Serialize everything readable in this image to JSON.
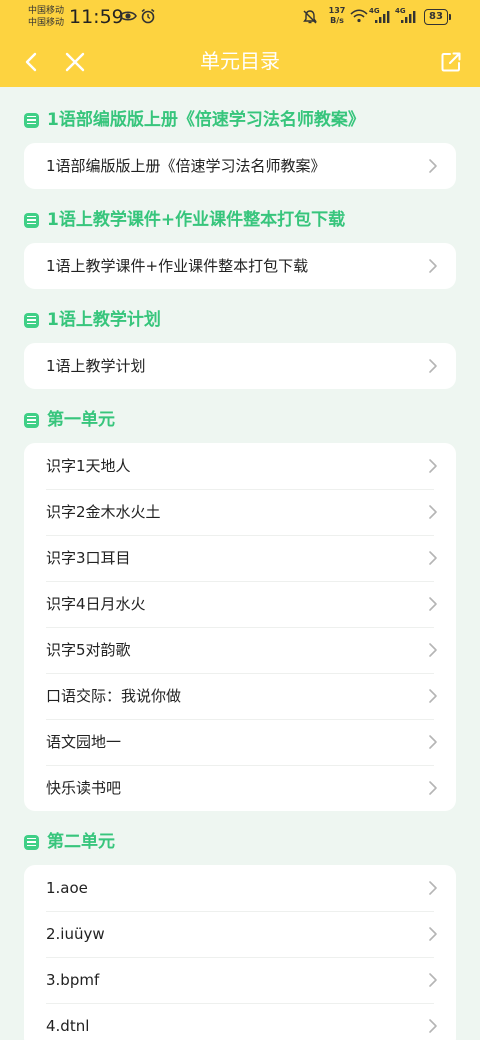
{
  "status_bar": {
    "carrier_1": "中国移动",
    "carrier_2": "中国移动",
    "time": "11:59",
    "net_speed_value": "137",
    "net_speed_unit": "B/s",
    "signal_1_label": "4G",
    "signal_2_label": "4G",
    "battery": "83"
  },
  "nav": {
    "title": "单元目录",
    "back_icon": "chevron-left-icon",
    "close_icon": "close-icon",
    "share_icon": "share-icon"
  },
  "sections": [
    {
      "title": "1语部编版版上册《倍速学习法名师教案》",
      "items": [
        "1语部编版版上册《倍速学习法名师教案》"
      ]
    },
    {
      "title": "1语上教学课件+作业课件整本打包下载",
      "items": [
        "1语上教学课件+作业课件整本打包下载"
      ]
    },
    {
      "title": "1语上教学计划",
      "items": [
        "1语上教学计划"
      ]
    },
    {
      "title": "第一单元",
      "items": [
        "识字1天地人",
        "识字2金木水火土",
        "识字3口耳目",
        "识字4日月水火",
        "识字5对韵歌",
        "口语交际：我说你做",
        "语文园地一",
        "快乐读书吧"
      ]
    },
    {
      "title": "第二单元",
      "items": [
        "1.aoe",
        "2.iuüyw",
        "3.bpmf",
        "4.dtnl"
      ]
    }
  ],
  "colors": {
    "header": "#fdd340",
    "accent_green": "#37c57c",
    "background": "#eef6f1"
  }
}
